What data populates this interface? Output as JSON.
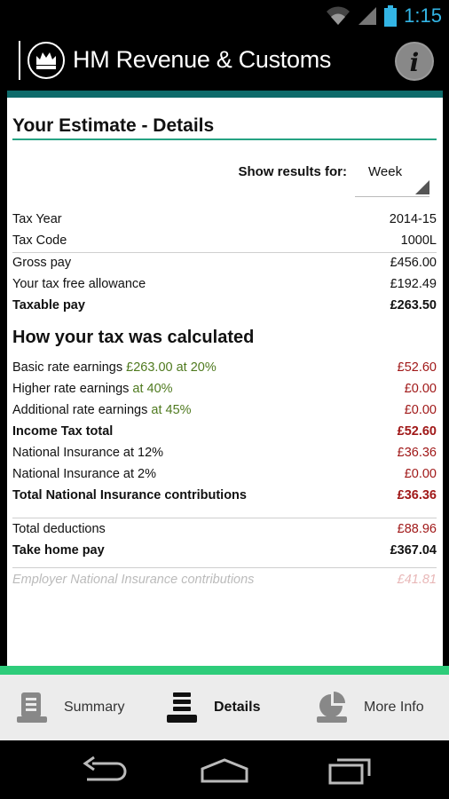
{
  "status_bar": {
    "time": "1:15"
  },
  "app_bar": {
    "title": "HM Revenue & Customs"
  },
  "page": {
    "title": "Your Estimate - Details"
  },
  "period": {
    "label": "Show results for:",
    "selected": "Week"
  },
  "summary_rows": [
    {
      "label": "Tax Year",
      "value": "2014-15"
    },
    {
      "label": "Tax Code",
      "value": "1000L"
    },
    {
      "label": "Gross pay",
      "value": "£456.00"
    },
    {
      "label": "Your tax free allowance",
      "value": "£192.49"
    },
    {
      "label": "Taxable pay",
      "value": "£263.50"
    }
  ],
  "calc": {
    "title": "How your tax was calculated",
    "rows": [
      {
        "label": "Basic rate earnings",
        "detail": "£263.00 at 20%",
        "value": "£52.60"
      },
      {
        "label": "Higher rate earnings",
        "detail": "at 40%",
        "value": "£0.00"
      },
      {
        "label": "Additional rate earnings",
        "detail": "at 45%",
        "value": "£0.00"
      },
      {
        "label": "Income Tax total",
        "value": "£52.60"
      },
      {
        "label": "National Insurance at 12%",
        "value": "£36.36"
      },
      {
        "label": "National Insurance at 2%",
        "value": "£0.00"
      },
      {
        "label": "Total National Insurance contributions",
        "value": "£36.36"
      }
    ]
  },
  "totals": [
    {
      "label": "Total deductions",
      "value": "£88.96"
    },
    {
      "label": "Take home pay",
      "value": "£367.04"
    }
  ],
  "employer": {
    "label": "Employer National Insurance contributions",
    "value": "£41.81"
  },
  "tabs": [
    {
      "label": "Summary",
      "icon": "document-icon"
    },
    {
      "label": "Details",
      "icon": "stack-icon"
    },
    {
      "label": "More Info",
      "icon": "pie-chart-icon"
    }
  ],
  "colors": {
    "teal": "#0e6b6b",
    "accent_green": "#2ecc7a",
    "amount_red": "#a01818",
    "rate_green": "#4f7a1f",
    "clock_blue": "#33b5e5"
  }
}
